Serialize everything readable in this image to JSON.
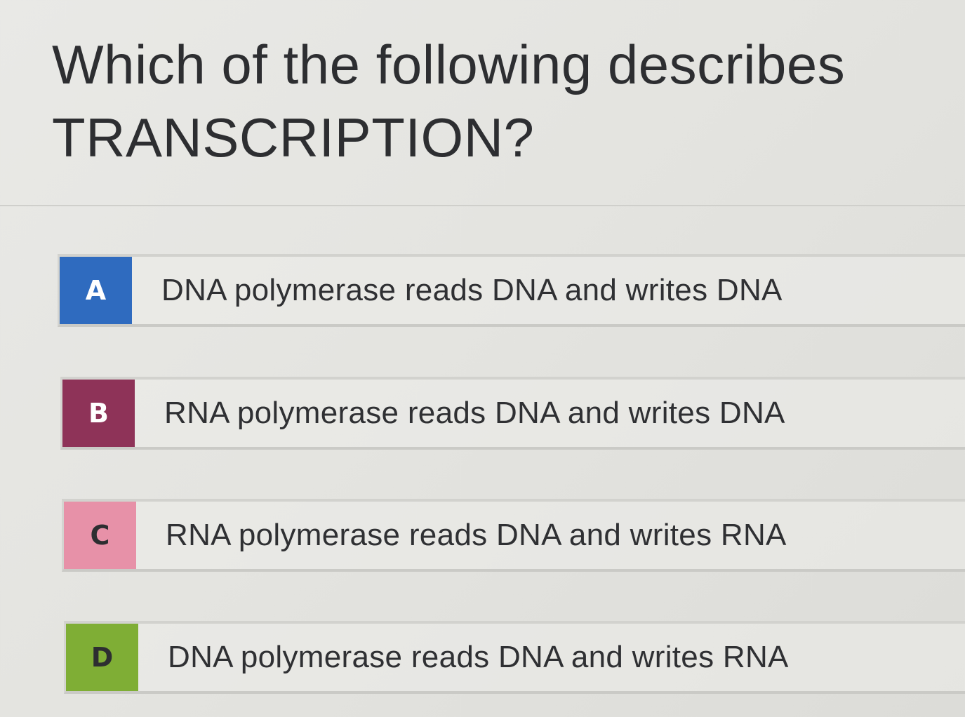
{
  "question": {
    "line1": "Which of the following describes",
    "line2": "TRANSCRIPTION?"
  },
  "options": [
    {
      "letter": "A",
      "text": "DNA polymerase reads DNA and writes DNA",
      "color": "#2f6bbf",
      "letter_color": "#ffffff"
    },
    {
      "letter": "B",
      "text": "RNA polymerase reads DNA and writes DNA",
      "color": "#8e3358",
      "letter_color": "#ffffff"
    },
    {
      "letter": "C",
      "text": "RNA polymerase reads DNA and writes RNA",
      "color": "#e791a8",
      "letter_color": "#2d2e31"
    },
    {
      "letter": "D",
      "text": "DNA polymerase reads DNA and writes RNA",
      "color": "#7fae35",
      "letter_color": "#2d2e31"
    }
  ]
}
